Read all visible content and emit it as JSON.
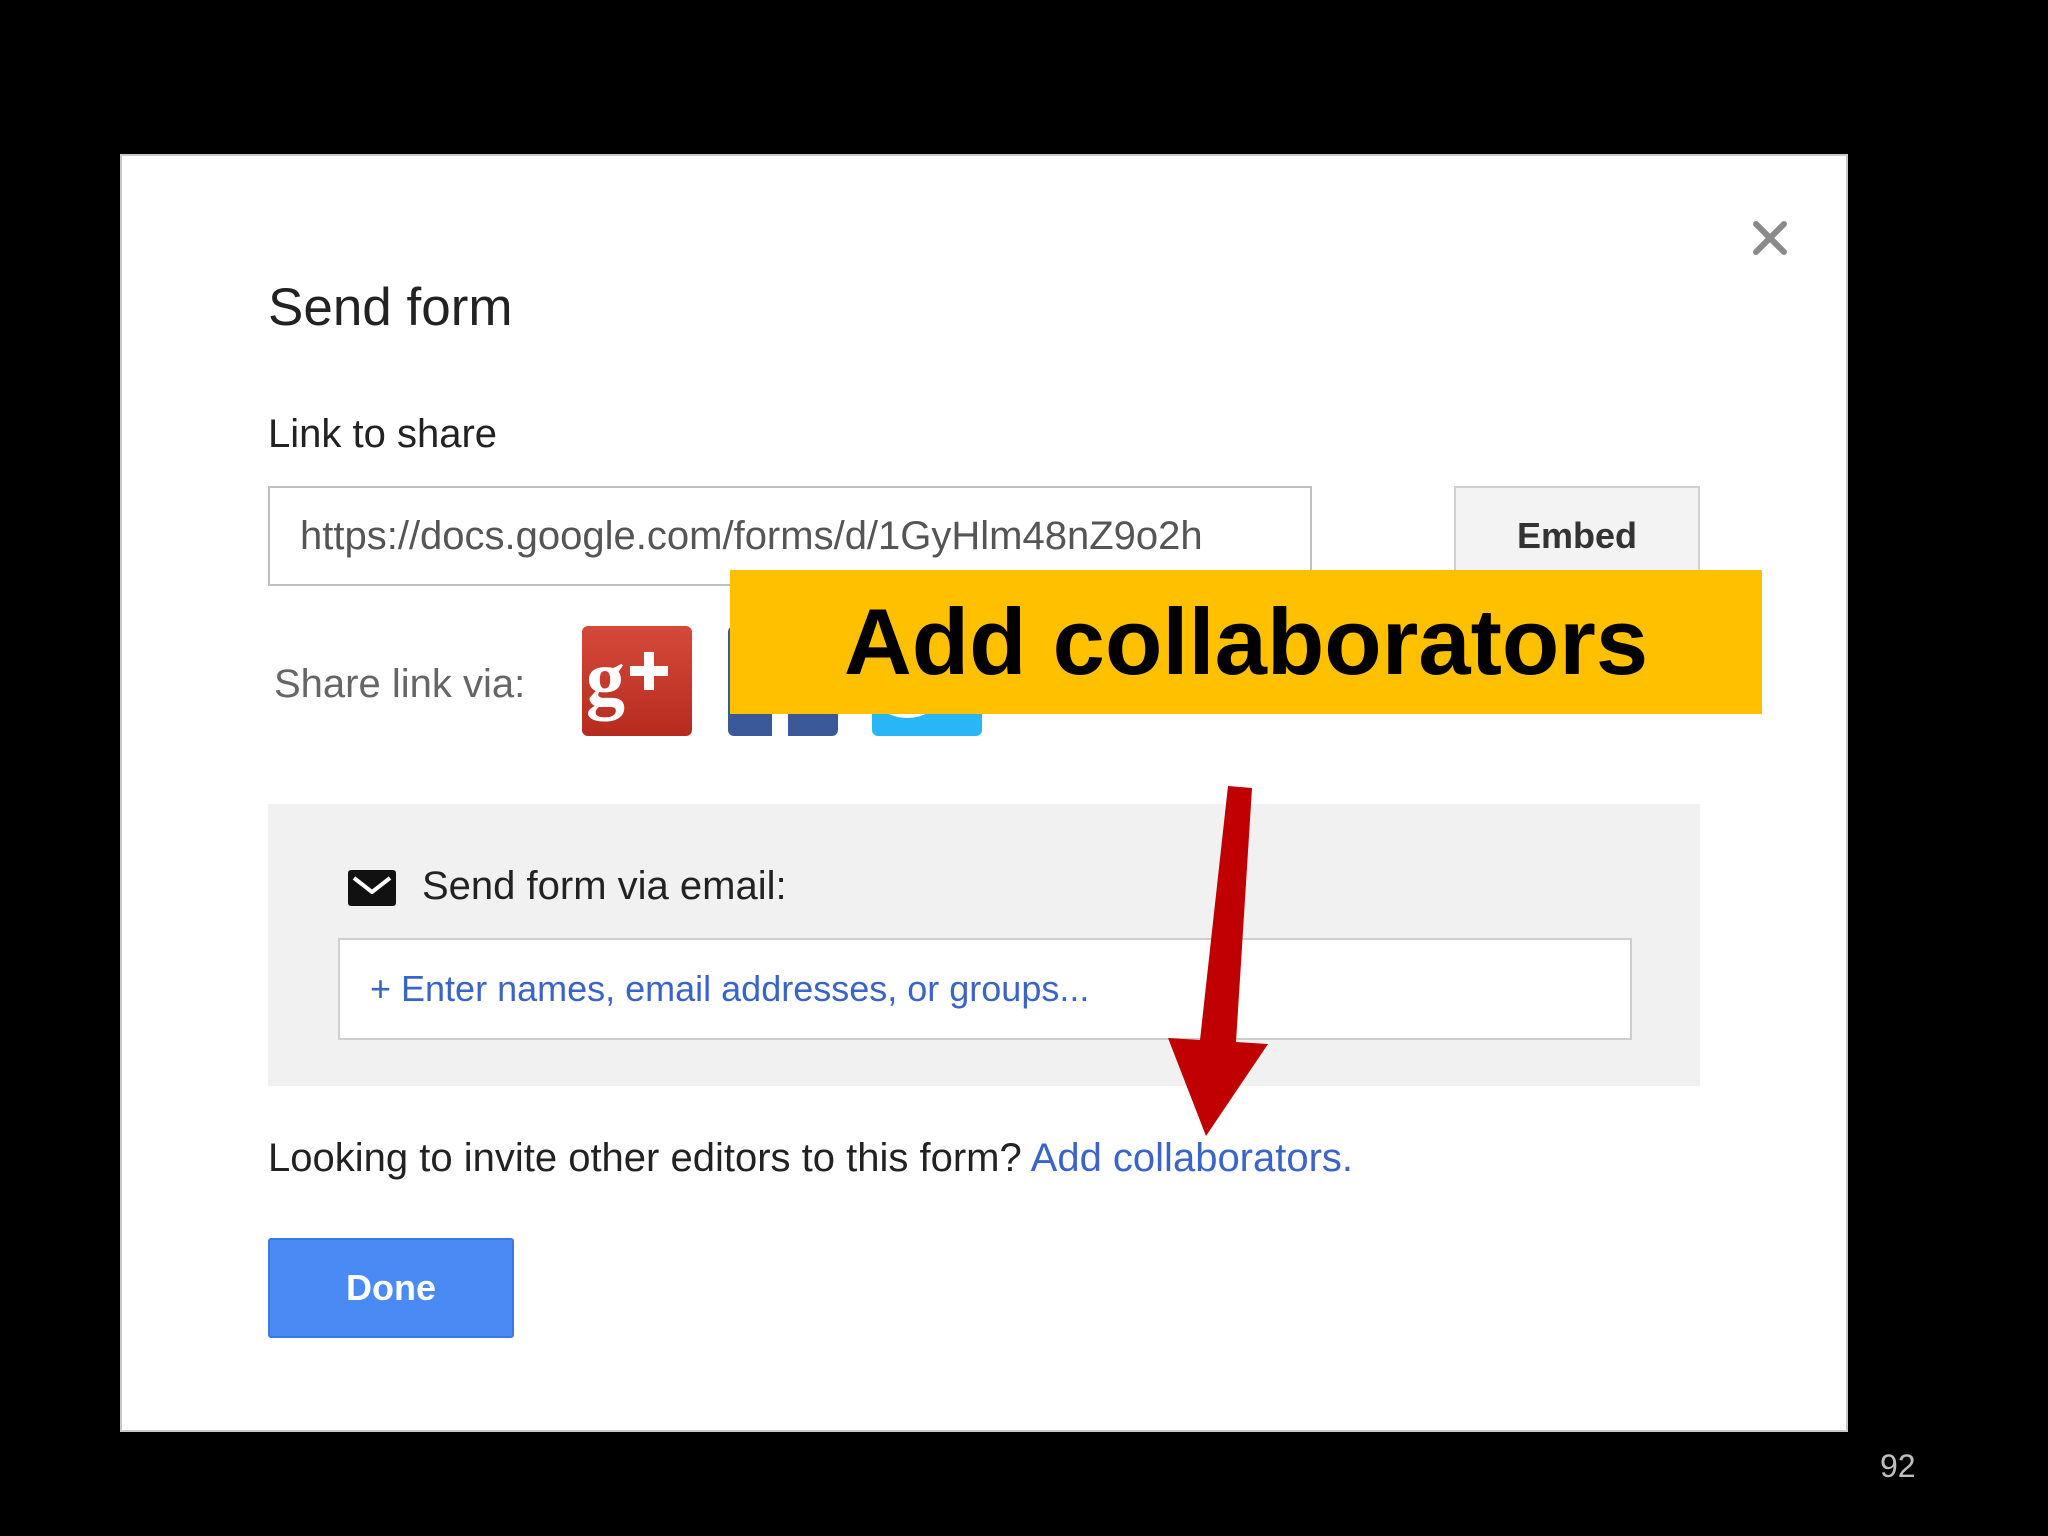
{
  "dialog": {
    "title": "Send form",
    "link_label": "Link to share",
    "link_value": "https://docs.google.com/forms/d/1GyHlm48nZ9o2h",
    "embed_label": "Embed",
    "share_label": "Share link via:",
    "social": [
      {
        "name": "google-plus",
        "glyph": "g+"
      },
      {
        "name": "facebook"
      },
      {
        "name": "twitter"
      }
    ],
    "email_label": "Send form via email:",
    "email_placeholder": "+ Enter names, email addresses, or groups...",
    "invite_text": "Looking to invite other editors to this form?",
    "invite_link": "Add collaborators.",
    "done_label": "Done",
    "close_icon": "close-icon"
  },
  "annotation": {
    "callout_text": "Add collaborators",
    "callout_color": "#ffc000",
    "arrow_color": "#c00000"
  },
  "slide": {
    "page_number": "92"
  }
}
